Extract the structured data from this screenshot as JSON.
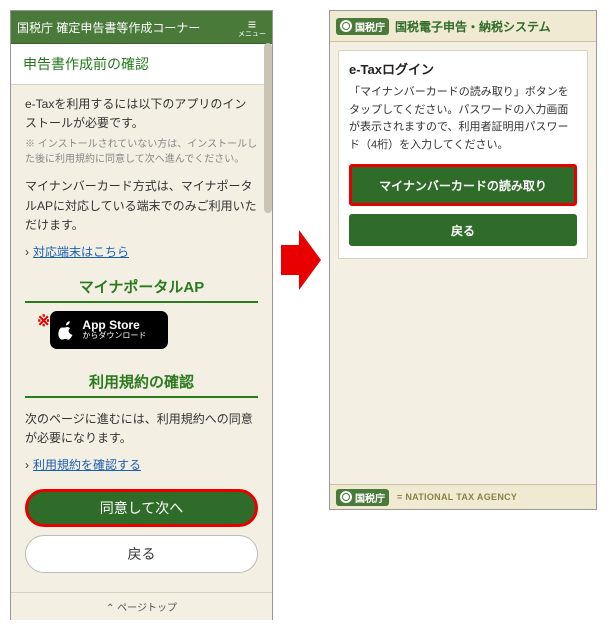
{
  "left": {
    "header_title": "国税庁 確定申告書等作成コーナー",
    "menu_label": "メニュー",
    "section_title": "申告書作成前の確認",
    "intro_text": "e-Taxを利用するには以下のアプリのインストールが必要です。",
    "note_text": "※ インストールされていない方は、インストールした後に利用規約に同意して次へ進んでください。",
    "mynumber_text": "マイナンバーカード方式は、マイナポータルAPに対応している端末でのみご利用いただけます。",
    "devices_link": "対応端末はこちら",
    "mynaportal_heading": "マイナポータルAP",
    "star": "※",
    "appstore_big": "App Store",
    "appstore_small": "からダウンロード",
    "terms_heading": "利用規約の確認",
    "terms_text": "次のページに進むには、利用規約への同意が必要になります。",
    "terms_link": "利用規約を確認する",
    "agree_btn": "同意して次へ",
    "back_btn": "戻る",
    "page_top": "ページトップ"
  },
  "right": {
    "badge": "国税庁",
    "system_title": "国税電子申告・納税システム",
    "panel_title": "e-Taxログイン",
    "panel_text": "「マイナンバーカードの読み取り」ボタンをタップしてください。パスワードの入力画面が表示されますので、利用者証明用パスワード（4桁）を入力してください。",
    "read_btn": "マイナンバーカードの読み取り",
    "back_btn": "戻る",
    "footer_badge": "国税庁",
    "footer_agency": "= NATIONAL TAX AGENCY"
  }
}
